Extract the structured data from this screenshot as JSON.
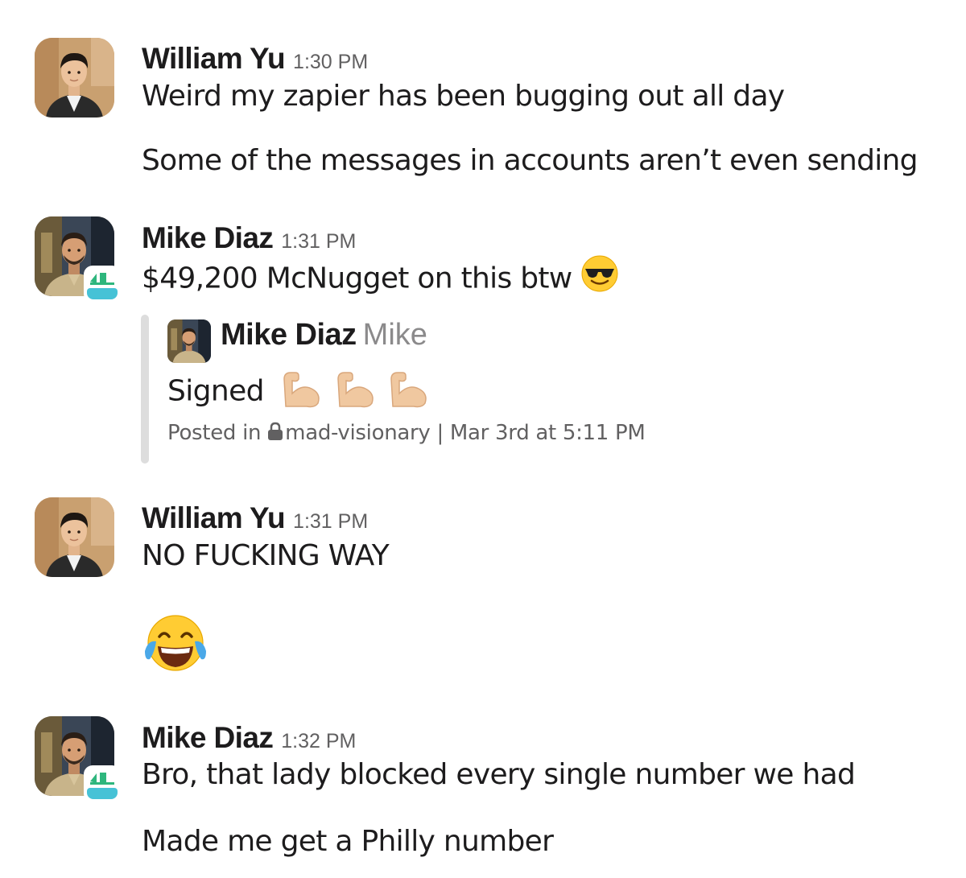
{
  "messages": [
    {
      "sender": "William Yu",
      "time": "1:30 PM",
      "avatar": "avatar-william-yu",
      "lines": [
        "Weird my zapier has been bugging out all day",
        "Some of the messages in accounts aren’t even sending"
      ]
    },
    {
      "sender": "Mike Diaz",
      "time": "1:31 PM",
      "avatar": "avatar-mike-diaz",
      "app_badge": "app-badge-icon",
      "lines": [
        "$49,200 McNugget on this btw"
      ],
      "emoji": "sunglasses-emoji",
      "quote": {
        "name": "Mike Diaz",
        "alias": "Mike",
        "text": "Signed",
        "emojis": [
          "flexed-biceps-emoji",
          "flexed-biceps-emoji",
          "flexed-biceps-emoji"
        ],
        "posted_in_label": "Posted in",
        "channel": "mad-visionary",
        "channel_icon": "lock-icon",
        "separator": "|",
        "date": "Mar 3rd at 5:11 PM"
      }
    },
    {
      "sender": "William Yu",
      "time": "1:31 PM",
      "avatar": "avatar-william-yu",
      "lines": [
        "NO FUCKING WAY"
      ],
      "emoji": "tears-of-joy-emoji"
    },
    {
      "sender": "Mike Diaz",
      "time": "1:32 PM",
      "avatar": "avatar-mike-diaz",
      "app_badge": "app-badge-icon",
      "lines": [
        "Bro, that lady blocked every single number we had",
        "Made me get a Philly number"
      ]
    }
  ],
  "colors": {
    "text": "#1d1c1d",
    "timestamp": "#616061",
    "alias": "#8b8a8b",
    "quote_bar": "#dddddd",
    "badge_green": "#2eb67d",
    "badge_teal": "#36c5f0",
    "emoji_yellow": "#ffcc33"
  }
}
